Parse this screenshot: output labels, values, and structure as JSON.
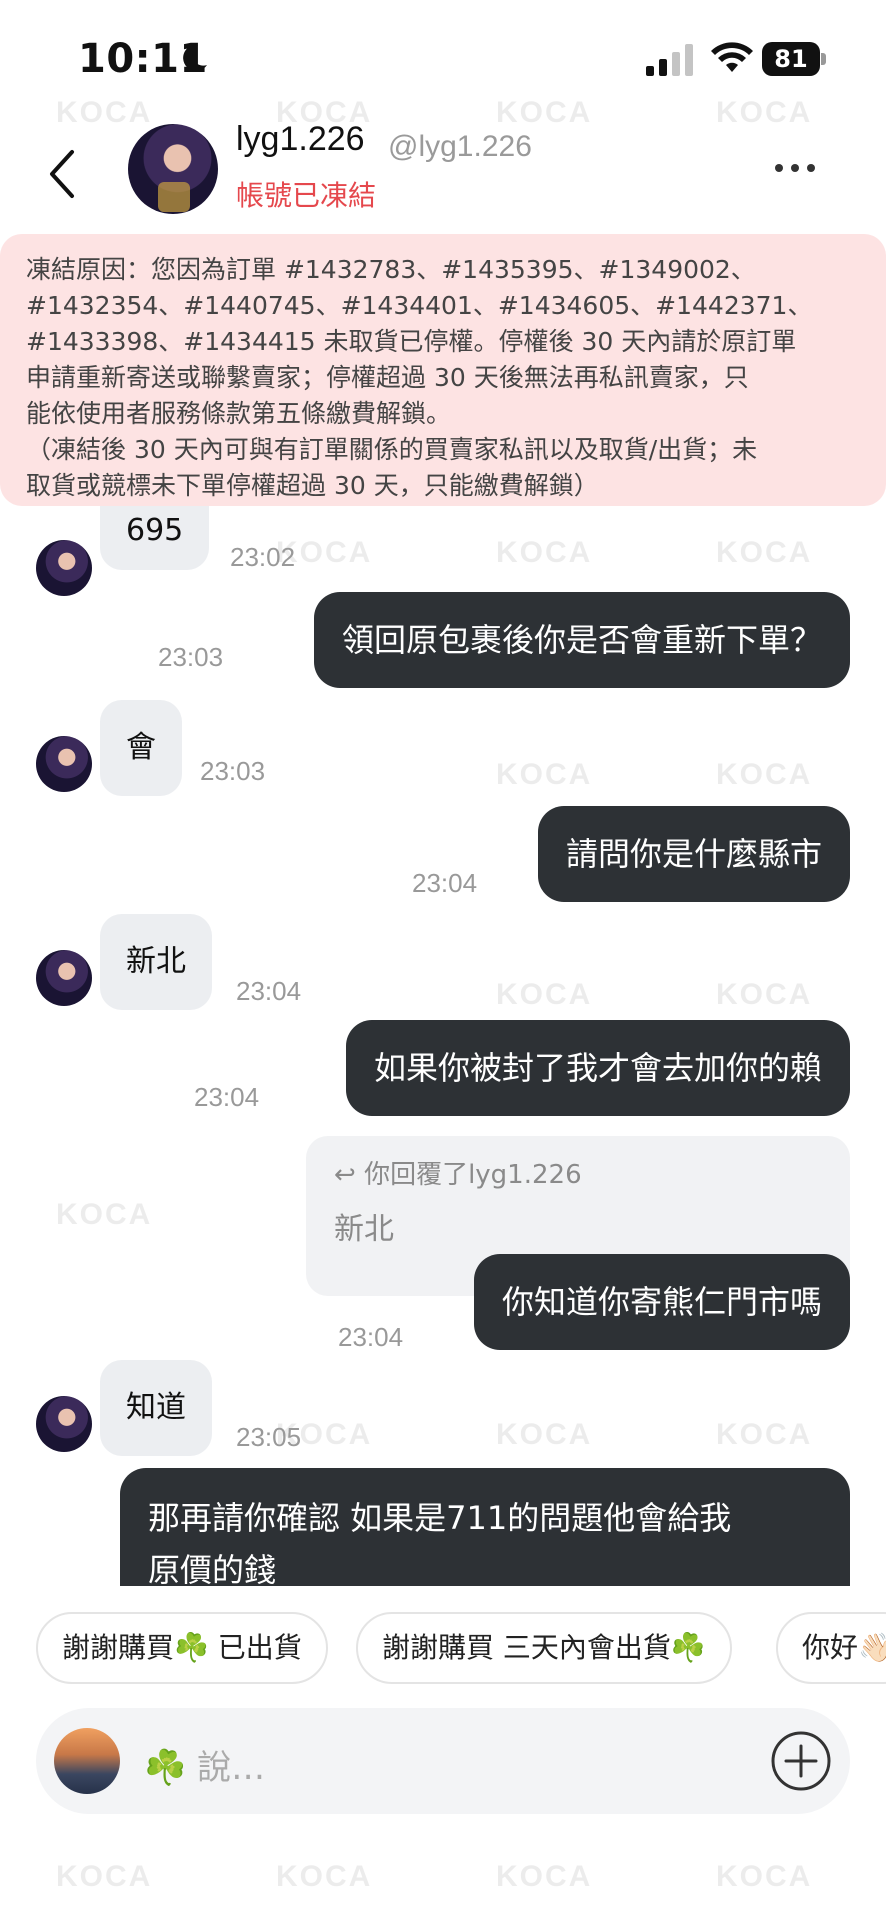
{
  "status_bar": {
    "time": "10:11",
    "battery": "81"
  },
  "header": {
    "username": "lyg1.226",
    "handle": "@lyg1.226",
    "account_status": "帳號已凍結"
  },
  "notice": {
    "line1": "凍結原因：您因為訂單 #1432783、#1435395、#1349002、",
    "line2": "#1432354、#1440745、#1434401、#1434605、#1442371、",
    "line3": "#1433398、#1434415 未取貨已停權。停權後 30 天內請於原訂單",
    "line4": "申請重新寄送或聯繫賣家；停權超過 30 天後無法再私訊賣家，只",
    "line5": "能依使用者服務條款第五條繳費解鎖。",
    "line6": "（凍結後 30 天內可與有訂單關係的買賣家私訊以及取貨/出貨；未",
    "line7": "取貨或競標未下單停權超過 30 天，只能繳費解鎖）"
  },
  "messages": {
    "m1": {
      "text": "695",
      "time": "23:02"
    },
    "m2": {
      "text": "領回原包裹後你是否會重新下單？",
      "time": "23:03"
    },
    "m3": {
      "text": "會",
      "time": "23:03"
    },
    "m4": {
      "text": "請問你是什麼縣市",
      "time": "23:04"
    },
    "m5": {
      "text": "新北",
      "time": "23:04"
    },
    "m6": {
      "text": "如果你被封了我才會去加你的賴",
      "time": "23:04"
    },
    "m7": {
      "reply_to": "你回覆了lyg1.226",
      "reply_text": "新北",
      "text": "你知道你寄熊仁門市嗎",
      "time": "23:04"
    },
    "m8": {
      "text": "知道",
      "time": "23:05"
    },
    "m9": {
      "line1": "那再請你確認 如果是711的問題他會給我",
      "line2": "原價的錢"
    }
  },
  "quick_replies": [
    "謝謝購買☘️ 已出貨",
    "謝謝購買 三天內會出貨☘️",
    "你好👋🏻"
  ],
  "input": {
    "prefix": "☘️",
    "placeholder": "說…"
  },
  "watermark": "KOCA"
}
